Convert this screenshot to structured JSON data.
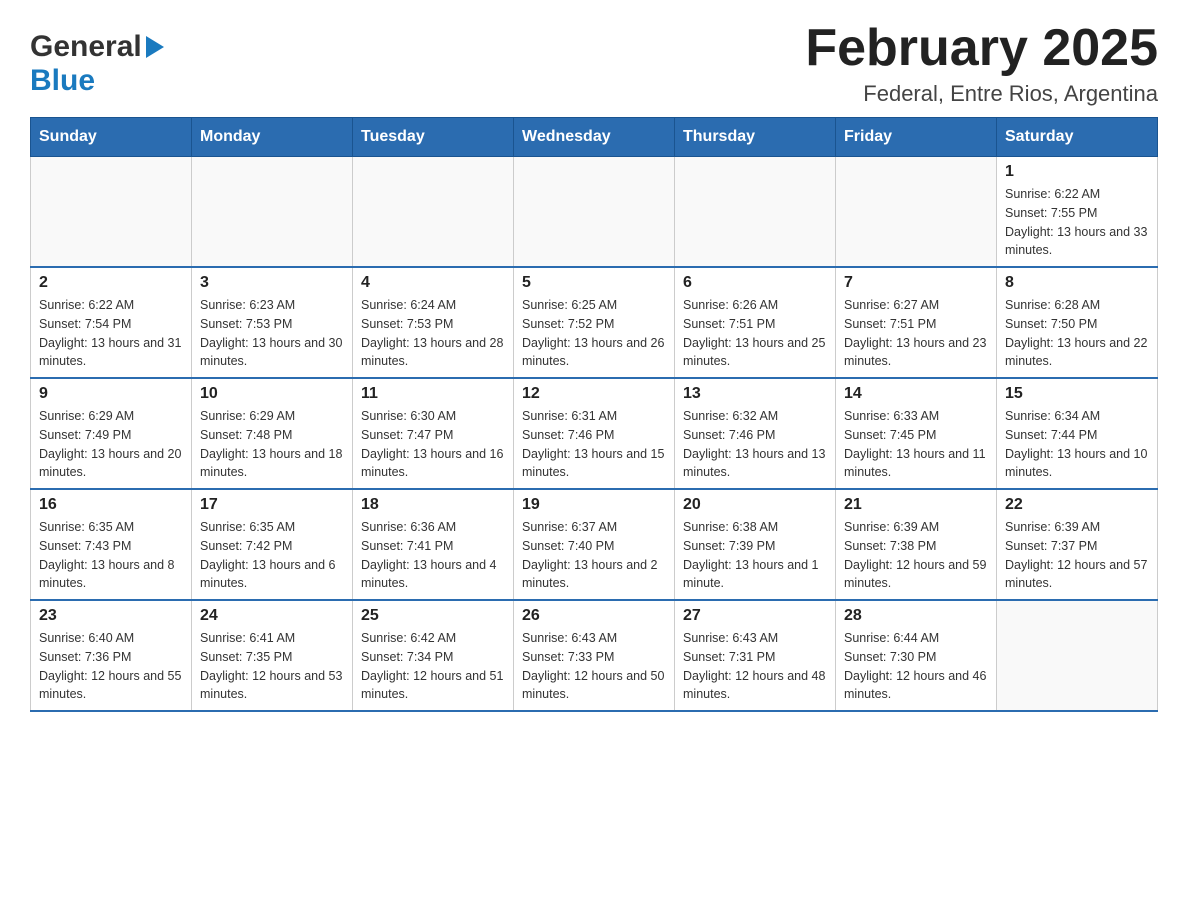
{
  "header": {
    "logo_general": "General",
    "logo_blue": "Blue",
    "month_title": "February 2025",
    "location": "Federal, Entre Rios, Argentina"
  },
  "weekdays": [
    "Sunday",
    "Monday",
    "Tuesday",
    "Wednesday",
    "Thursday",
    "Friday",
    "Saturday"
  ],
  "weeks": [
    [
      {
        "day": "",
        "sunrise": "",
        "sunset": "",
        "daylight": ""
      },
      {
        "day": "",
        "sunrise": "",
        "sunset": "",
        "daylight": ""
      },
      {
        "day": "",
        "sunrise": "",
        "sunset": "",
        "daylight": ""
      },
      {
        "day": "",
        "sunrise": "",
        "sunset": "",
        "daylight": ""
      },
      {
        "day": "",
        "sunrise": "",
        "sunset": "",
        "daylight": ""
      },
      {
        "day": "",
        "sunrise": "",
        "sunset": "",
        "daylight": ""
      },
      {
        "day": "1",
        "sunrise": "Sunrise: 6:22 AM",
        "sunset": "Sunset: 7:55 PM",
        "daylight": "Daylight: 13 hours and 33 minutes."
      }
    ],
    [
      {
        "day": "2",
        "sunrise": "Sunrise: 6:22 AM",
        "sunset": "Sunset: 7:54 PM",
        "daylight": "Daylight: 13 hours and 31 minutes."
      },
      {
        "day": "3",
        "sunrise": "Sunrise: 6:23 AM",
        "sunset": "Sunset: 7:53 PM",
        "daylight": "Daylight: 13 hours and 30 minutes."
      },
      {
        "day": "4",
        "sunrise": "Sunrise: 6:24 AM",
        "sunset": "Sunset: 7:53 PM",
        "daylight": "Daylight: 13 hours and 28 minutes."
      },
      {
        "day": "5",
        "sunrise": "Sunrise: 6:25 AM",
        "sunset": "Sunset: 7:52 PM",
        "daylight": "Daylight: 13 hours and 26 minutes."
      },
      {
        "day": "6",
        "sunrise": "Sunrise: 6:26 AM",
        "sunset": "Sunset: 7:51 PM",
        "daylight": "Daylight: 13 hours and 25 minutes."
      },
      {
        "day": "7",
        "sunrise": "Sunrise: 6:27 AM",
        "sunset": "Sunset: 7:51 PM",
        "daylight": "Daylight: 13 hours and 23 minutes."
      },
      {
        "day": "8",
        "sunrise": "Sunrise: 6:28 AM",
        "sunset": "Sunset: 7:50 PM",
        "daylight": "Daylight: 13 hours and 22 minutes."
      }
    ],
    [
      {
        "day": "9",
        "sunrise": "Sunrise: 6:29 AM",
        "sunset": "Sunset: 7:49 PM",
        "daylight": "Daylight: 13 hours and 20 minutes."
      },
      {
        "day": "10",
        "sunrise": "Sunrise: 6:29 AM",
        "sunset": "Sunset: 7:48 PM",
        "daylight": "Daylight: 13 hours and 18 minutes."
      },
      {
        "day": "11",
        "sunrise": "Sunrise: 6:30 AM",
        "sunset": "Sunset: 7:47 PM",
        "daylight": "Daylight: 13 hours and 16 minutes."
      },
      {
        "day": "12",
        "sunrise": "Sunrise: 6:31 AM",
        "sunset": "Sunset: 7:46 PM",
        "daylight": "Daylight: 13 hours and 15 minutes."
      },
      {
        "day": "13",
        "sunrise": "Sunrise: 6:32 AM",
        "sunset": "Sunset: 7:46 PM",
        "daylight": "Daylight: 13 hours and 13 minutes."
      },
      {
        "day": "14",
        "sunrise": "Sunrise: 6:33 AM",
        "sunset": "Sunset: 7:45 PM",
        "daylight": "Daylight: 13 hours and 11 minutes."
      },
      {
        "day": "15",
        "sunrise": "Sunrise: 6:34 AM",
        "sunset": "Sunset: 7:44 PM",
        "daylight": "Daylight: 13 hours and 10 minutes."
      }
    ],
    [
      {
        "day": "16",
        "sunrise": "Sunrise: 6:35 AM",
        "sunset": "Sunset: 7:43 PM",
        "daylight": "Daylight: 13 hours and 8 minutes."
      },
      {
        "day": "17",
        "sunrise": "Sunrise: 6:35 AM",
        "sunset": "Sunset: 7:42 PM",
        "daylight": "Daylight: 13 hours and 6 minutes."
      },
      {
        "day": "18",
        "sunrise": "Sunrise: 6:36 AM",
        "sunset": "Sunset: 7:41 PM",
        "daylight": "Daylight: 13 hours and 4 minutes."
      },
      {
        "day": "19",
        "sunrise": "Sunrise: 6:37 AM",
        "sunset": "Sunset: 7:40 PM",
        "daylight": "Daylight: 13 hours and 2 minutes."
      },
      {
        "day": "20",
        "sunrise": "Sunrise: 6:38 AM",
        "sunset": "Sunset: 7:39 PM",
        "daylight": "Daylight: 13 hours and 1 minute."
      },
      {
        "day": "21",
        "sunrise": "Sunrise: 6:39 AM",
        "sunset": "Sunset: 7:38 PM",
        "daylight": "Daylight: 12 hours and 59 minutes."
      },
      {
        "day": "22",
        "sunrise": "Sunrise: 6:39 AM",
        "sunset": "Sunset: 7:37 PM",
        "daylight": "Daylight: 12 hours and 57 minutes."
      }
    ],
    [
      {
        "day": "23",
        "sunrise": "Sunrise: 6:40 AM",
        "sunset": "Sunset: 7:36 PM",
        "daylight": "Daylight: 12 hours and 55 minutes."
      },
      {
        "day": "24",
        "sunrise": "Sunrise: 6:41 AM",
        "sunset": "Sunset: 7:35 PM",
        "daylight": "Daylight: 12 hours and 53 minutes."
      },
      {
        "day": "25",
        "sunrise": "Sunrise: 6:42 AM",
        "sunset": "Sunset: 7:34 PM",
        "daylight": "Daylight: 12 hours and 51 minutes."
      },
      {
        "day": "26",
        "sunrise": "Sunrise: 6:43 AM",
        "sunset": "Sunset: 7:33 PM",
        "daylight": "Daylight: 12 hours and 50 minutes."
      },
      {
        "day": "27",
        "sunrise": "Sunrise: 6:43 AM",
        "sunset": "Sunset: 7:31 PM",
        "daylight": "Daylight: 12 hours and 48 minutes."
      },
      {
        "day": "28",
        "sunrise": "Sunrise: 6:44 AM",
        "sunset": "Sunset: 7:30 PM",
        "daylight": "Daylight: 12 hours and 46 minutes."
      },
      {
        "day": "",
        "sunrise": "",
        "sunset": "",
        "daylight": ""
      }
    ]
  ]
}
